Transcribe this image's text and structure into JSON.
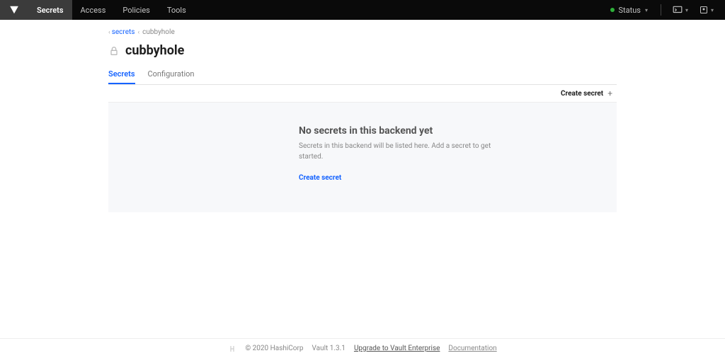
{
  "nav": {
    "items": [
      "Secrets",
      "Access",
      "Policies",
      "Tools"
    ],
    "active_index": 0,
    "status_label": "Status"
  },
  "breadcrumb": {
    "parent": "secrets",
    "current": "cubbyhole"
  },
  "page": {
    "title": "cubbyhole",
    "tabs": [
      "Secrets",
      "Configuration"
    ],
    "active_tab_index": 0,
    "create_button": "Create secret"
  },
  "empty": {
    "title": "No secrets in this backend yet",
    "body": "Secrets in this backend will be listed here. Add a secret to get started.",
    "link": "Create secret"
  },
  "footer": {
    "copyright": "© 2020 HashiCorp",
    "version": "Vault 1.3.1",
    "upgrade": "Upgrade to Vault Enterprise",
    "docs": "Documentation"
  }
}
